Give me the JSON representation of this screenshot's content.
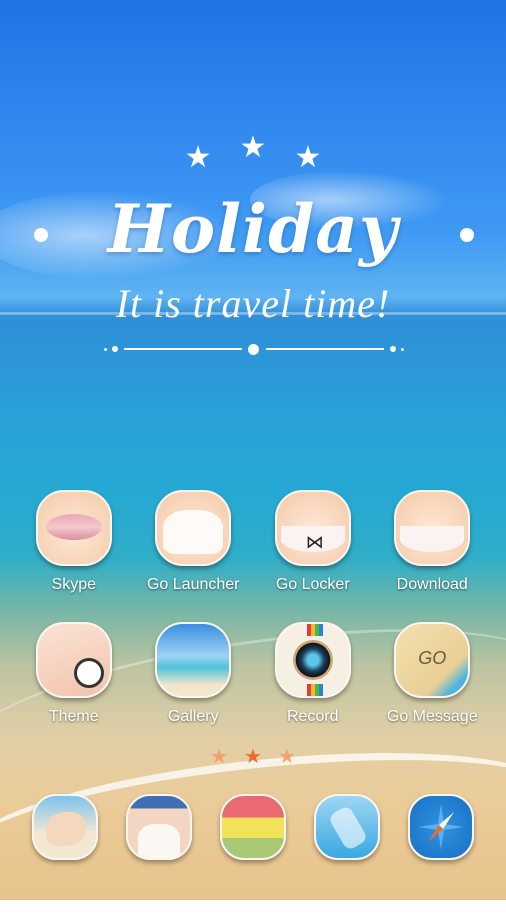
{
  "widget": {
    "stars": [
      "★",
      "★",
      "★"
    ],
    "title": "Holiday",
    "subtitle": "It is travel time!"
  },
  "apps": [
    {
      "label": "Skype",
      "icon": "lips-icon"
    },
    {
      "label": "Go Launcher",
      "icon": "bikini-top-icon"
    },
    {
      "label": "Go Locker",
      "icon": "bow-underwear-icon"
    },
    {
      "label": "Download",
      "icon": "bikini-bottom-icon"
    },
    {
      "label": "Theme",
      "icon": "manicure-icon"
    },
    {
      "label": "Gallery",
      "icon": "beach-photo-icon"
    },
    {
      "label": "Record",
      "icon": "camera-icon"
    },
    {
      "label": "Go Message",
      "icon": "sand-writing-icon"
    }
  ],
  "gomsg_text": "GO",
  "pager": {
    "pages": [
      "★",
      "★",
      "★"
    ],
    "active_index": 1
  },
  "dock": [
    {
      "icon": "seashell-icon"
    },
    {
      "icon": "swimsuit-woman-icon"
    },
    {
      "icon": "messages-icon"
    },
    {
      "icon": "message-bottle-icon"
    },
    {
      "icon": "compass-browser-icon"
    }
  ],
  "colors": {
    "sky": "#2f86ee",
    "sea": "#26a9d3",
    "sand": "#e8c38c",
    "pager_active": "#ee6a2c",
    "pager_inactive": "#f4a070"
  }
}
